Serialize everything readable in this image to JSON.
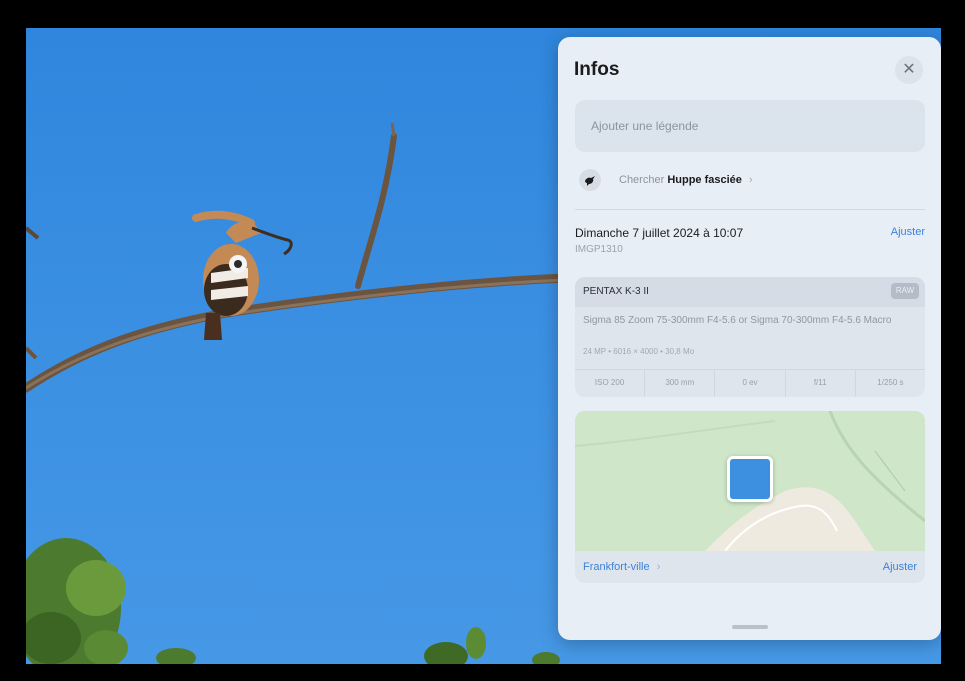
{
  "panel": {
    "title": "Infos",
    "close_icon": "close-icon",
    "caption_placeholder": "Ajouter une légende",
    "lookup": {
      "icon": "bird-icon",
      "prefix": "Chercher",
      "subject": "Huppe fasciée",
      "chevron": "›"
    },
    "date": {
      "label": "Dimanche 7 juillet 2024 à 10:07",
      "filename": "IMGP1310",
      "adjust_label": "Ajuster"
    },
    "exif": {
      "camera": "PENTAX K-3 II",
      "format": "RAW",
      "lens": "Sigma 85 Zoom 75-300mm F4-5.6 or Sigma 70-300mm F4-5.6 Macro",
      "specs": "24 MP • 6016 × 4000 • 30,8 Mo",
      "stats": [
        "ISO 200",
        "300 mm",
        "0 ev",
        "f/11",
        "1/250 s"
      ]
    },
    "map": {
      "location_label": "Frankfort-ville",
      "location_chevron": "›",
      "adjust_label": "Ajuster"
    }
  },
  "colors": {
    "accent": "#3b82d8",
    "sky": "#3a8fe2",
    "panel_bg": "#e8eef5"
  }
}
